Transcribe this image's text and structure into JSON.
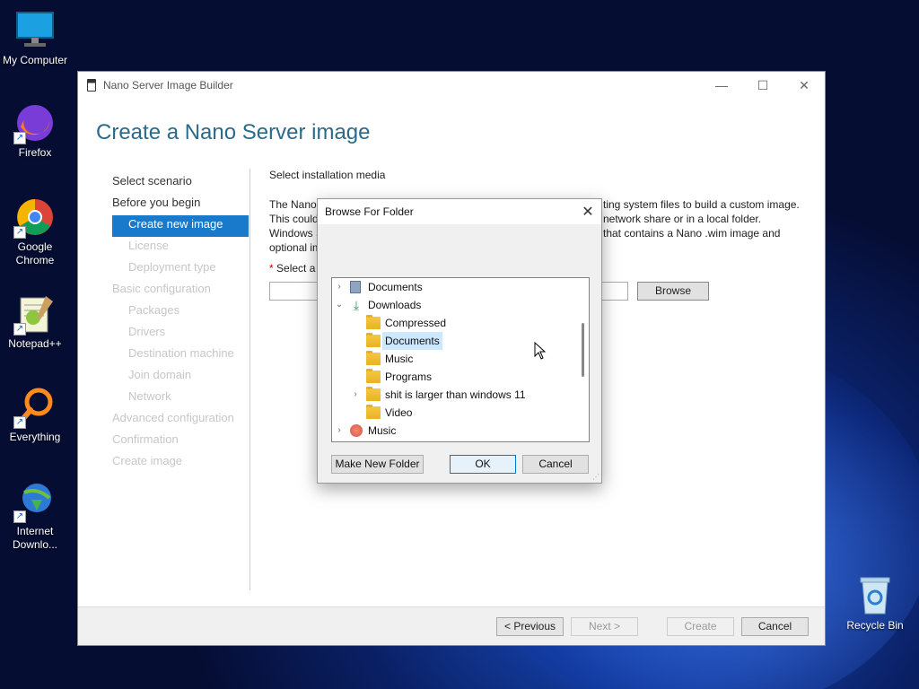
{
  "desktop": {
    "icons": [
      {
        "label": "My Computer",
        "icon": "monitor-icon"
      },
      {
        "label": "Firefox",
        "icon": "firefox-icon"
      },
      {
        "label": "Google Chrome",
        "icon": "chrome-icon"
      },
      {
        "label": "Notepad++",
        "icon": "notepadpp-icon"
      },
      {
        "label": "Everything",
        "icon": "search-magnifier-icon"
      },
      {
        "label": "Internet Downlo...",
        "icon": "idm-icon"
      },
      {
        "label": "Recycle Bin",
        "icon": "recycle-bin-icon"
      }
    ]
  },
  "window": {
    "title": "Nano Server Image Builder",
    "page_title": "Create a Nano Server image",
    "nav": [
      {
        "label": "Select scenario",
        "state": "normal",
        "level": 0
      },
      {
        "label": "Before you begin",
        "state": "normal",
        "level": 0
      },
      {
        "label": "Create new image",
        "state": "active",
        "level": 1
      },
      {
        "label": "License",
        "state": "disabled",
        "level": 1
      },
      {
        "label": "Deployment type",
        "state": "disabled",
        "level": 1
      },
      {
        "label": "Basic configuration",
        "state": "disabled",
        "level": 0
      },
      {
        "label": "Packages",
        "state": "disabled",
        "level": 1
      },
      {
        "label": "Drivers",
        "state": "disabled",
        "level": 1
      },
      {
        "label": "Destination machine",
        "state": "disabled",
        "level": 1
      },
      {
        "label": "Join domain",
        "state": "disabled",
        "level": 1
      },
      {
        "label": "Network",
        "state": "disabled",
        "level": 1
      },
      {
        "label": "Advanced configuration",
        "state": "disabled",
        "level": 0
      },
      {
        "label": "Confirmation",
        "state": "disabled",
        "level": 0
      },
      {
        "label": "Create image",
        "state": "disabled",
        "level": 0
      }
    ],
    "content": {
      "section_title": "Select installation media",
      "desc_lines": [
        "The Nano",
        "This could",
        "Windows S",
        "optional im"
      ],
      "desc_lines_right": [
        "ting system files to build a custom image.",
        "network share or in a local folder.",
        "that contains a Nano .wim image and"
      ],
      "select_label": "Select a l",
      "browse_label": "Browse"
    },
    "footer": {
      "previous": "< Previous",
      "next": "Next >",
      "create": "Create",
      "cancel": "Cancel"
    }
  },
  "dialog": {
    "title": "Browse For Folder",
    "tree": [
      {
        "label": "Documents",
        "indent": 0,
        "expander": "collapsed",
        "icon": "documents-icon"
      },
      {
        "label": "Downloads",
        "indent": 0,
        "expander": "expanded",
        "icon": "downloads-icon"
      },
      {
        "label": "Compressed",
        "indent": 1,
        "expander": "none",
        "icon": "folder-icon"
      },
      {
        "label": "Documents",
        "indent": 1,
        "expander": "none",
        "icon": "folder-icon",
        "selected": true
      },
      {
        "label": "Music",
        "indent": 1,
        "expander": "none",
        "icon": "folder-icon"
      },
      {
        "label": "Programs",
        "indent": 1,
        "expander": "none",
        "icon": "folder-icon"
      },
      {
        "label": "shit is larger than windows 11",
        "indent": 1,
        "expander": "collapsed",
        "icon": "folder-icon"
      },
      {
        "label": "Video",
        "indent": 1,
        "expander": "none",
        "icon": "folder-icon"
      },
      {
        "label": "Music",
        "indent": 0,
        "expander": "collapsed",
        "icon": "music-icon"
      }
    ],
    "buttons": {
      "make_new_folder": "Make New Folder",
      "ok": "OK",
      "cancel": "Cancel"
    }
  }
}
